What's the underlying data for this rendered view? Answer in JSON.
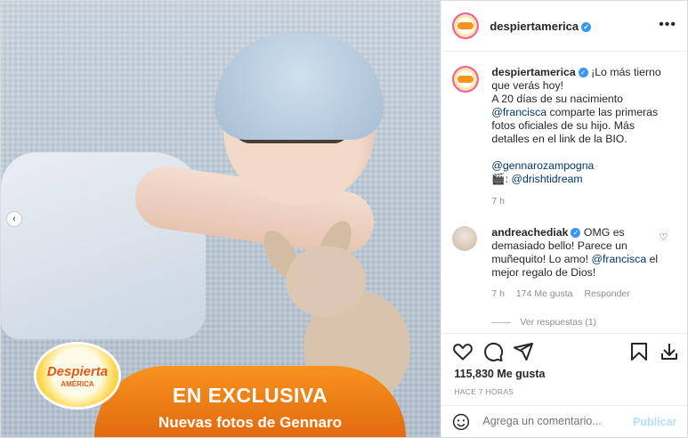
{
  "media": {
    "banner_line1": "EN EXCLUSIVA",
    "banner_line2": "Nuevas fotos de Gennaro",
    "logo_text": "Despierta",
    "logo_sub": "AMÉRICA"
  },
  "header": {
    "username": "despiertamerica",
    "more_label": "•••"
  },
  "caption": {
    "username": "despiertamerica",
    "text1": "¡Lo más tierno que verás hoy!",
    "text2_pre": "A 20 días de su nacimiento ",
    "text2_mention": "@francisca",
    "text2_post": " comparte las primeras fotos oficiales de su hijo. Más detalles en el link de la BIO.",
    "mention2": "@gennarozampogna",
    "clapper": "🎬: ",
    "mention3": "@drishtidream",
    "time": "7 h"
  },
  "comment": {
    "username": "andreachediak",
    "text_pre": "OMG es demasiado bello! Parece un muñequito! Lo amo! ",
    "mention": "@francisca",
    "text_post": " el mejor regalo de Dios!",
    "time": "7 h",
    "likes": "174 Me gusta",
    "reply": "Responder",
    "view_replies": "Ver respuestas (1)"
  },
  "actions": {
    "likes": "115,830 Me gusta",
    "ago": "HACE 7 HORAS"
  },
  "comment_box": {
    "placeholder": "Agrega un comentario...",
    "publish": "Publicar"
  }
}
